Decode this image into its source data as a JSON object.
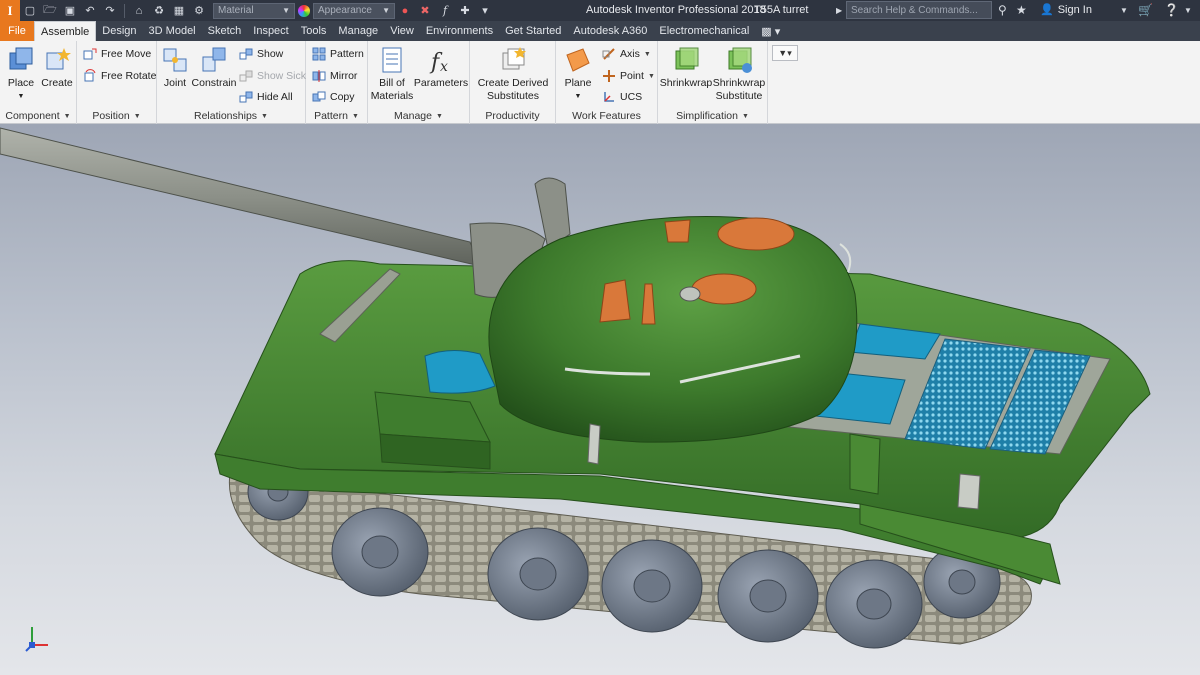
{
  "titlebar": {
    "app_title": "Autodesk Inventor Professional 2018",
    "doc_title": "T55A turret",
    "material_placeholder": "Material",
    "appearance_placeholder": "Appearance",
    "help_placeholder": "Search Help & Commands...",
    "signin": "Sign In",
    "logo_letter": "I"
  },
  "tabs": [
    {
      "label": "File"
    },
    {
      "label": "Assemble"
    },
    {
      "label": "Design"
    },
    {
      "label": "3D Model"
    },
    {
      "label": "Sketch"
    },
    {
      "label": "Inspect"
    },
    {
      "label": "Tools"
    },
    {
      "label": "Manage"
    },
    {
      "label": "View"
    },
    {
      "label": "Environments"
    },
    {
      "label": "Get Started"
    },
    {
      "label": "Autodesk A360"
    },
    {
      "label": "Electromechanical"
    }
  ],
  "ribbon": {
    "component": {
      "label": "Component",
      "place": "Place",
      "create": "Create"
    },
    "position": {
      "label": "Position",
      "free_move": "Free Move",
      "free_rotate": "Free Rotate"
    },
    "relationships": {
      "label": "Relationships",
      "joint": "Joint",
      "constrain": "Constrain",
      "show": "Show",
      "show_sick": "Show Sick",
      "hide_all": "Hide All"
    },
    "pattern": {
      "label": "Pattern",
      "pattern": "Pattern",
      "mirror": "Mirror",
      "copy": "Copy"
    },
    "manage": {
      "label": "Manage",
      "bom_1": "Bill of",
      "bom_2": "Materials",
      "parameters": "Parameters"
    },
    "productivity": {
      "label": "Productivity",
      "derived_1": "Create Derived",
      "derived_2": "Substitutes"
    },
    "work_features": {
      "label": "Work Features",
      "plane": "Plane",
      "axis": "Axis",
      "point": "Point",
      "ucs": "UCS"
    },
    "simplification": {
      "label": "Simplification",
      "shrinkwrap": "Shrinkwrap",
      "sw_sub_1": "Shrinkwrap",
      "sw_sub_2": "Substitute"
    }
  },
  "colors": {
    "hull_green": "#4a8a34",
    "turret_green": "#3f7d2e",
    "hatch_orange": "#d9783a",
    "blue_panel": "#1f9bc7",
    "gun_grey": "#8a8f86",
    "track_grey": "#9a9888",
    "wheel_blue_grey": "#7b8595"
  }
}
